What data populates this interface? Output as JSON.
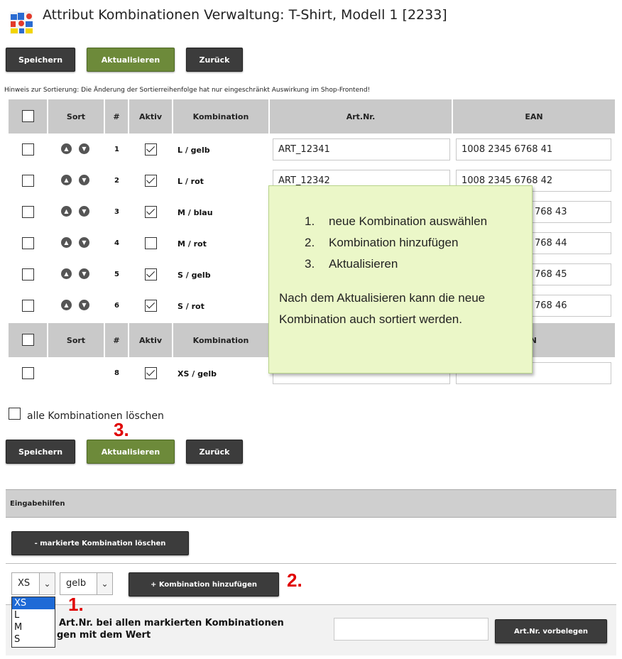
{
  "header": {
    "title": "Attribut Kombinationen Verwaltung: T-Shirt, Modell 1 [2233]"
  },
  "toolbar": {
    "save": "Speichern",
    "update": "Aktualisieren",
    "back": "Zurück"
  },
  "hint": "Hinweis zur Sortierung: Die Änderung der Sortierreihenfolge hat nur eingeschränkt Auswirkung im Shop-Frontend!",
  "table": {
    "headers": [
      "Sort",
      "#",
      "Aktiv",
      "Kombination",
      "Art.Nr.",
      "EAN"
    ],
    "rows": [
      {
        "num": "1",
        "active": true,
        "combo": "L / gelb",
        "artnr": "ART_12341",
        "ean": "1008 2345 6768 41"
      },
      {
        "num": "2",
        "active": true,
        "combo": "L / rot",
        "artnr": "ART_12342",
        "ean": "1008 2345 6768 42"
      },
      {
        "num": "3",
        "active": true,
        "combo": "M / blau",
        "artnr": "",
        "ean": "768 43"
      },
      {
        "num": "4",
        "active": false,
        "combo": "M / rot",
        "artnr": "",
        "ean": "768 44"
      },
      {
        "num": "5",
        "active": true,
        "combo": "S / gelb",
        "artnr": "",
        "ean": "768 45"
      },
      {
        "num": "6",
        "active": true,
        "combo": "S / rot",
        "artnr": "",
        "ean": "768 46"
      }
    ],
    "headers2": [
      "Sort",
      "#",
      "Aktiv",
      "Kombination",
      "AN"
    ],
    "new_row": {
      "num": "8",
      "active": true,
      "combo": "XS / gelb"
    }
  },
  "tooltip": {
    "steps": [
      {
        "n": "1.",
        "text": "neue Kombination auswählen"
      },
      {
        "n": "2.",
        "text": "Kombination hinzufügen"
      },
      {
        "n": "3.",
        "text": "Aktualisieren"
      }
    ],
    "note_line1": "Nach dem Aktualisieren kann die neue",
    "note_line2": "Kombination auch sortiert werden."
  },
  "delete_all_label": "alle Kombinationen löschen",
  "callouts": {
    "one": "1.",
    "two": "2.",
    "three": "3."
  },
  "aids": {
    "title": "Eingabehilfen",
    "delete_marked": "- markierte Kombination löschen",
    "size_value": "XS",
    "size_options": [
      "XS",
      "L",
      "M",
      "S"
    ],
    "color_value": "gelb",
    "add_combo": "+ Kombination hinzufügen",
    "artnr_line1": "l Art.Nr. bei allen markierten Kombinationen",
    "artnr_line2": "gen mit dem Wert",
    "artnr_value": "",
    "artnr_button": "Art.Nr. vorbelegen"
  },
  "colors": {
    "header_bg": "#c9c9c9",
    "button_dark": "#3c3c3c",
    "button_green": "#6d8a3a",
    "tooltip_bg": "#ebf7c8",
    "callout_red": "#e00000",
    "dropdown_highlight": "#1e6ad6"
  }
}
